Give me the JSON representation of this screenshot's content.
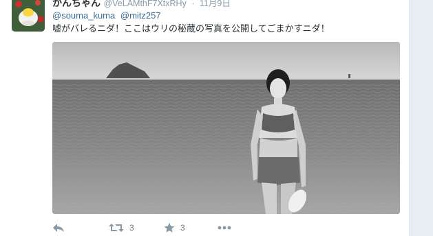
{
  "tweet": {
    "author_name": "かんちゃん",
    "author_handle": "@VeLAMthF7XtxRHy",
    "separator": "·",
    "timestamp": "11月9日",
    "reply_to": [
      "@souma_kuma",
      "@mitz257"
    ],
    "text": "嘘がバレるニダ！ここはウリの秘蔵の写真を公開してごまかすニダ！"
  },
  "actions": {
    "reply_icon": "reply-icon",
    "retweet_icon": "retweet-icon",
    "retweet_count": "3",
    "favorite_icon": "star-icon",
    "favorite_count": "3",
    "more_icon": "more-dots-icon"
  },
  "colors": {
    "link": "#3b6c91",
    "name": "#292f33",
    "meta": "#8899a6",
    "icon": "#8899a6"
  }
}
